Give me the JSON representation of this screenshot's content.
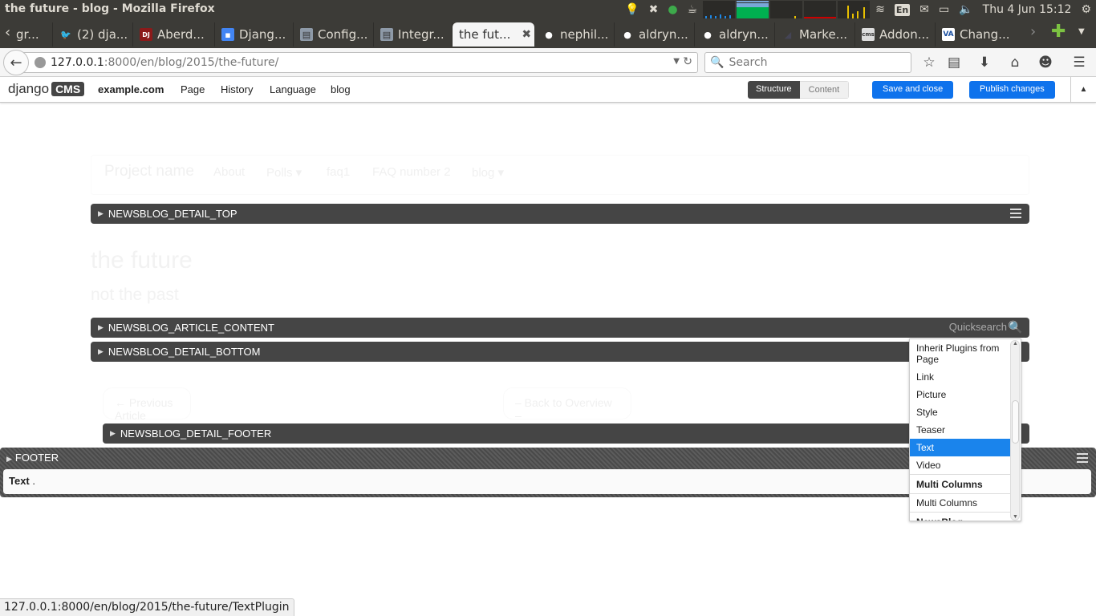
{
  "os": {
    "window_title": "the future - blog - Mozilla Firefox",
    "language_indicator": "En",
    "clock": "Thu 4 Jun 15:12"
  },
  "tabs": [
    {
      "label": "gr...",
      "icon": "generic-page-icon"
    },
    {
      "label": "(2) dja...",
      "icon": "twitter-icon"
    },
    {
      "label": "Aberd...",
      "icon": "djeu-icon"
    },
    {
      "label": "Djang...",
      "icon": "google-slides-icon"
    },
    {
      "label": "Config...",
      "icon": "docs-icon"
    },
    {
      "label": "Integr...",
      "icon": "docs-icon"
    },
    {
      "label": "the fut...",
      "icon": "",
      "active": true
    },
    {
      "label": "nephil...",
      "icon": "github-icon"
    },
    {
      "label": "aldryn...",
      "icon": "github-icon"
    },
    {
      "label": "aldryn...",
      "icon": "github-icon"
    },
    {
      "label": "Marke...",
      "icon": "marker-icon"
    },
    {
      "label": "Addon...",
      "icon": "cms-icon"
    },
    {
      "label": "Chang...",
      "icon": "va-icon"
    }
  ],
  "navbar": {
    "url_host": "127.0.0.1",
    "url_rest": ":8000/en/blog/2015/the-future/",
    "search_placeholder": "Search"
  },
  "cms_toolbar": {
    "logo_text": "django",
    "logo_badge": "CMS",
    "site": "example.com",
    "menu": [
      "Page",
      "History",
      "Language",
      "blog"
    ],
    "mode_structure": "Structure",
    "mode_content": "Content",
    "save_label": "Save and close",
    "publish_label": "Publish changes"
  },
  "page": {
    "brand": "Project name",
    "nav": [
      "About",
      "Polls ▾",
      "faq1",
      "FAQ number 2",
      "blog ▾"
    ],
    "title": "the future",
    "subtitle": "not the past",
    "prev_article": "← Previous Article",
    "back_overview": "– Back to Overview –"
  },
  "placeholders": {
    "detail_top": "NEWSBLOG_DETAIL_TOP",
    "article_content": "NEWSBLOG_ARTICLE_CONTENT",
    "detail_bottom": "NEWSBLOG_DETAIL_BOTTOM",
    "detail_footer": "NEWSBLOG_DETAIL_FOOTER",
    "footer": "FOOTER",
    "quicksearch": "Quicksearch",
    "footer_plugin_name": "Text",
    "footer_plugin_suffix": " ."
  },
  "picker": {
    "items": [
      {
        "label": "Inherit Plugins from Page",
        "type": "item"
      },
      {
        "label": "Link",
        "type": "item"
      },
      {
        "label": "Picture",
        "type": "item"
      },
      {
        "label": "Style",
        "type": "item"
      },
      {
        "label": "Teaser",
        "type": "item"
      },
      {
        "label": "Text",
        "type": "item",
        "selected": true
      },
      {
        "label": "Video",
        "type": "item"
      },
      {
        "label": "Multi Columns",
        "type": "group"
      },
      {
        "label": "Multi Columns",
        "type": "item"
      },
      {
        "label": "NewsBlog",
        "type": "group"
      }
    ]
  },
  "statusbar": {
    "text": "127.0.0.1:8000/en/blog/2015/the-future/TextPlugin"
  }
}
